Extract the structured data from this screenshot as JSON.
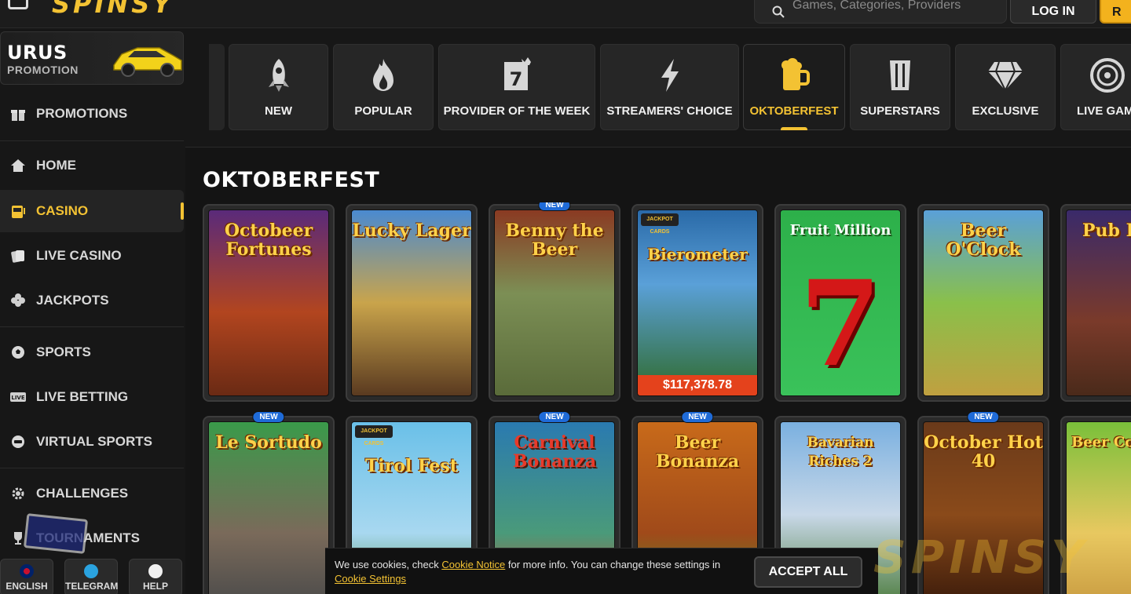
{
  "header": {
    "logo_text": "SPINSY",
    "search_placeholder": "Games, Categories, Providers",
    "login_label": "LOG IN",
    "register_label_partial": "R"
  },
  "sidebar": {
    "promo": {
      "title": "URUS",
      "subtitle": "PROMOTION"
    },
    "items": [
      {
        "label": "PROMOTIONS",
        "icon": "gift-icon"
      },
      {
        "label": "HOME",
        "icon": "home-icon"
      },
      {
        "label": "CASINO",
        "icon": "slot-machine-icon",
        "active": true
      },
      {
        "label": "LIVE CASINO",
        "icon": "cards-icon"
      },
      {
        "label": "JACKPOTS",
        "icon": "clover-icon"
      },
      {
        "label": "SPORTS",
        "icon": "ball-icon"
      },
      {
        "label": "LIVE BETTING",
        "icon": "live-icon"
      },
      {
        "label": "VIRTUAL SPORTS",
        "icon": "vr-icon"
      },
      {
        "label": "CHALLENGES",
        "icon": "gear-icon"
      },
      {
        "label": "TOURNAMENTS",
        "icon": "trophy-icon"
      }
    ],
    "bottom": {
      "language": "ENGLISH",
      "telegram": "TELEGRAM",
      "help": "HELP"
    }
  },
  "categories": [
    {
      "label": "NEW",
      "icon": "rocket-icon"
    },
    {
      "label": "POPULAR",
      "icon": "flame-icon"
    },
    {
      "label": "PROVIDER OF THE WEEK",
      "icon": "calendar-seven-icon"
    },
    {
      "label": "STREAMERS' CHOICE",
      "icon": "lightning-icon"
    },
    {
      "label": "OKTOBERFEST",
      "icon": "beer-mug-icon",
      "active": true
    },
    {
      "label": "SUPERSTARS",
      "icon": "trophy-pillar-icon"
    },
    {
      "label": "EXCLUSIVE",
      "icon": "diamond-icon"
    },
    {
      "label": "LIVE GAM",
      "icon": "roulette-icon"
    }
  ],
  "section": {
    "title": "OKTOBERFEST"
  },
  "games_row1": [
    {
      "name": "Octobeer Fortunes",
      "new": false
    },
    {
      "name": "Lucky Lager",
      "new": false
    },
    {
      "name": "Benny the Beer",
      "new": true
    },
    {
      "name": "Bierometer",
      "new": false,
      "jackpot": "JACKPOT CARDS",
      "amount": "$117,378.78"
    },
    {
      "name": "Fruit Million",
      "new": false
    },
    {
      "name": "Beer O'Clock",
      "new": false
    },
    {
      "name": "Pub Kin",
      "new": false
    }
  ],
  "games_row2": [
    {
      "name": "Le Sortudo",
      "new": true
    },
    {
      "name": "Tirol Fest",
      "new": false,
      "jackpot": "JACKPOT CARDS"
    },
    {
      "name": "Carnival Bonanza",
      "new": true
    },
    {
      "name": "Beer Bonanza",
      "new": true
    },
    {
      "name": "Bavarian Riches 2",
      "new": false
    },
    {
      "name": "October Hot 40",
      "new": true
    },
    {
      "name": "Beer Coll",
      "new": false
    }
  ],
  "badges": {
    "new": "NEW"
  },
  "cookie": {
    "text_before": "We use cookies, check ",
    "notice_link": "Cookie Notice",
    "text_middle": " for more info. You can change these settings in ",
    "settings_link": "Cookie Settings",
    "accept": "ACCEPT ALL"
  },
  "watermark": "SPINSY",
  "colors": {
    "accent": "#f3c233",
    "background": "#141414",
    "panel": "#262626",
    "new_badge": "#1f6bd8",
    "jackpot_amount": "#e4421c"
  }
}
